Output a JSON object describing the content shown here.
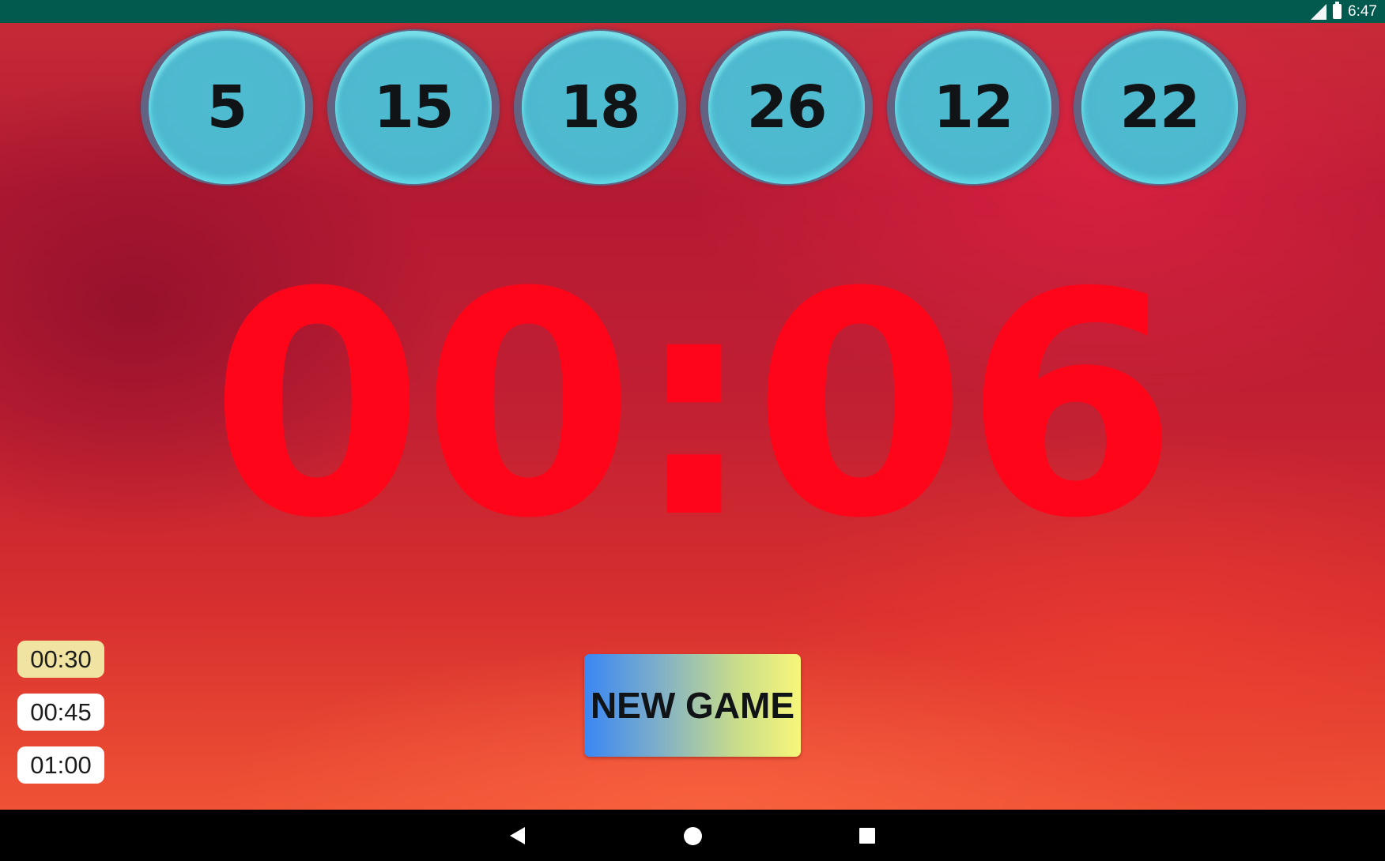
{
  "status_bar": {
    "time": "6:47",
    "icons": [
      "signal-icon",
      "battery-icon"
    ],
    "background_color": "#02594d"
  },
  "numbers": [
    "5",
    "15",
    "18",
    "26",
    "12",
    "22"
  ],
  "timer": {
    "display": "00:06",
    "color": "#ff0519"
  },
  "presets": [
    {
      "label": "00:30",
      "selected": true
    },
    {
      "label": "00:45",
      "selected": false
    },
    {
      "label": "01:00",
      "selected": false
    }
  ],
  "new_game_button": {
    "label": "NEW GAME"
  },
  "nav_bar": {
    "buttons": [
      "back-icon",
      "home-icon",
      "recents-icon"
    ]
  }
}
